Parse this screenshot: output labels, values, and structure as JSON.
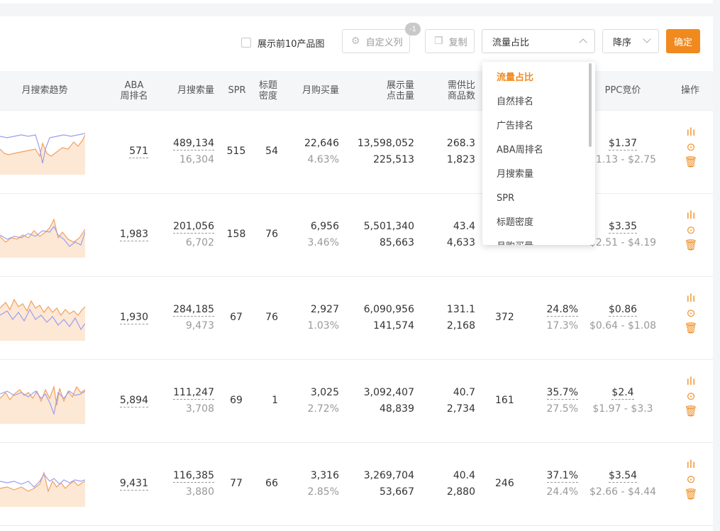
{
  "toolbar": {
    "checkbox_label": "展示前10产品图",
    "custom_columns_label": "自定义列",
    "custom_columns_badge": "-1",
    "copy_label": "复制",
    "sort_field_value": "流量占比",
    "sort_order_value": "降序",
    "confirm_label": "确定"
  },
  "headers": {
    "trend": "月搜索趋势",
    "aba_1": "ABA",
    "aba_2": "周排名",
    "search_vol": "月搜索量",
    "spr": "SPR",
    "title_1": "标题",
    "title_2": "密度",
    "buy_vol": "月购买量",
    "impr_1": "展示量",
    "impr_2": "点击量",
    "supply_1": "需供比",
    "supply_2": "商品数",
    "ppc": "PPC竞价",
    "ops": "操作"
  },
  "dropdown": {
    "items": [
      "流量占比",
      "自然排名",
      "广告排名",
      "ABA周排名",
      "月搜索量",
      "SPR",
      "标题密度",
      "月购买量"
    ],
    "active": "流量占比"
  },
  "rows": [
    {
      "aba": "571",
      "search": "489,134",
      "search_sub": "16,304",
      "spr": "515",
      "title": "54",
      "buy": "22,646",
      "buy_pct": "4.63%",
      "impr": "13,598,052",
      "click": "225,513",
      "supply": "268.3",
      "goods": "1,823",
      "col10": "",
      "share": "",
      "share_sub": "",
      "ppc": "$1.37",
      "ppc_range": "$1.13 - $2.75"
    },
    {
      "aba": "1,983",
      "search": "201,056",
      "search_sub": "6,702",
      "spr": "158",
      "title": "76",
      "buy": "6,956",
      "buy_pct": "3.46%",
      "impr": "5,501,340",
      "click": "85,663",
      "supply": "43.4",
      "goods": "4,633",
      "col10": "",
      "share": "",
      "share_sub": "",
      "ppc": "$3.35",
      "ppc_range": "$2.51 - $4.19"
    },
    {
      "aba": "1,930",
      "search": "284,185",
      "search_sub": "9,473",
      "spr": "67",
      "title": "76",
      "buy": "2,927",
      "buy_pct": "1.03%",
      "impr": "6,090,956",
      "click": "141,574",
      "supply": "131.1",
      "goods": "2,168",
      "col10": "372",
      "share": "24.8%",
      "share_sub": "17.3%",
      "ppc": "$0.86",
      "ppc_range": "$0.64 - $1.08"
    },
    {
      "aba": "5,894",
      "search": "111,247",
      "search_sub": "3,708",
      "spr": "69",
      "title": "1",
      "buy": "3,025",
      "buy_pct": "2.72%",
      "impr": "3,092,407",
      "click": "48,839",
      "supply": "40.7",
      "goods": "2,734",
      "col10": "161",
      "share": "35.7%",
      "share_sub": "27.5%",
      "ppc": "$2.4",
      "ppc_range": "$1.97 - $3.3"
    },
    {
      "aba": "9,431",
      "search": "116,385",
      "search_sub": "3,880",
      "spr": "77",
      "title": "66",
      "buy": "3,316",
      "buy_pct": "2.85%",
      "impr": "3,269,704",
      "click": "53,667",
      "supply": "40.4",
      "goods": "2,880",
      "col10": "246",
      "share": "37.1%",
      "share_sub": "24.4%",
      "ppc": "$3.54",
      "ppc_range": "$2.66 - $4.44"
    }
  ],
  "icons": {
    "row_actions": [
      "bar-chart-icon",
      "more-circle-icon",
      "trash-icon"
    ],
    "checkbox": "checkbox-icon",
    "custom_columns": "gear-icon",
    "copy": "copy-icon"
  },
  "colors": {
    "accent": "#f08a1e",
    "trend_line_a": "#f0a060",
    "trend_line_b": "#9a9ef0",
    "trend_fill": "#fde8d5"
  }
}
